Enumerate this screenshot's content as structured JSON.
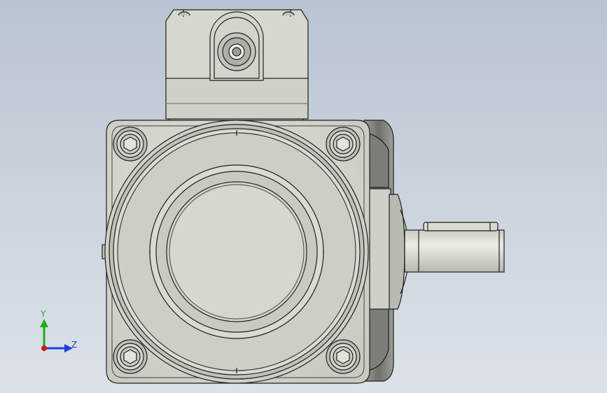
{
  "viewport": {
    "background_top": "#b9c4d2",
    "background_bottom": "#dde2e8"
  },
  "model": {
    "body_color": "#d7d9d0",
    "edge_color": "#1f1f1f",
    "shade_color": "#8f918a"
  },
  "triad": {
    "y_label": "Y",
    "z_label": "Z",
    "y_color": "#18b018",
    "z_color": "#1a3fe0",
    "x_color": "#d01818"
  }
}
